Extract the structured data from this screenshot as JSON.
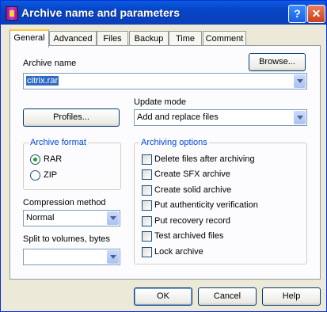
{
  "window": {
    "title": "Archive name and parameters",
    "help_glyph": "?",
    "close_glyph": "✕"
  },
  "tabs": [
    {
      "label": "General",
      "active": true
    },
    {
      "label": "Advanced"
    },
    {
      "label": "Files"
    },
    {
      "label": "Backup"
    },
    {
      "label": "Time"
    },
    {
      "label": "Comment"
    }
  ],
  "archive_name": {
    "label": "Archive name",
    "value": "citrix.rar",
    "browse_label": "Browse..."
  },
  "profiles_label": "Profiles...",
  "update_mode": {
    "label": "Update mode",
    "value": "Add and replace files"
  },
  "archive_format": {
    "title": "Archive format",
    "options": [
      {
        "label": "RAR",
        "selected": true
      },
      {
        "label": "ZIP",
        "selected": false
      }
    ]
  },
  "archiving_options": {
    "title": "Archiving options",
    "items": [
      {
        "label": "Delete files after archiving",
        "checked": false
      },
      {
        "label": "Create SFX archive",
        "checked": false
      },
      {
        "label": "Create solid archive",
        "checked": false
      },
      {
        "label": "Put authenticity verification",
        "checked": false
      },
      {
        "label": "Put recovery record",
        "checked": false
      },
      {
        "label": "Test archived files",
        "checked": false
      },
      {
        "label": "Lock archive",
        "checked": false
      }
    ]
  },
  "compression": {
    "label": "Compression method",
    "value": "Normal"
  },
  "split": {
    "label": "Split to volumes, bytes",
    "value": ""
  },
  "buttons": {
    "ok": "OK",
    "cancel": "Cancel",
    "help": "Help"
  },
  "colors": {
    "title_bar": "#0a5be0",
    "dialog_bg": "#ece9d8",
    "group_title": "#0046d5",
    "tab_highlight": "#ffc73c"
  }
}
